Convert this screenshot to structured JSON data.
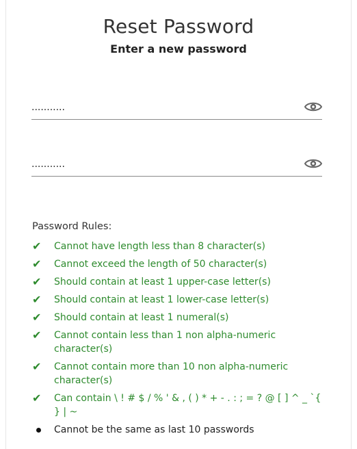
{
  "header": {
    "title": "Reset Password",
    "subtitle": "Enter a new password"
  },
  "fields": [
    {
      "name": "new-password",
      "value": "...........",
      "masked": true,
      "icon": "eye-icon"
    },
    {
      "name": "confirm-password",
      "value": "...........",
      "masked": true,
      "icon": "eye-icon"
    }
  ],
  "rules": {
    "title": "Password Rules:",
    "items": [
      {
        "text": "Cannot have length less than 8 character(s)",
        "status": "met"
      },
      {
        "text": "Cannot exceed the length of 50 character(s)",
        "status": "met"
      },
      {
        "text": "Should contain at least 1 upper-case letter(s)",
        "status": "met"
      },
      {
        "text": "Should contain at least 1 lower-case letter(s)",
        "status": "met"
      },
      {
        "text": "Should contain at least 1 numeral(s)",
        "status": "met"
      },
      {
        "text": "Cannot contain less than 1 non alpha-numeric character(s)",
        "status": "met"
      },
      {
        "text": "Cannot contain more than 10 non alpha-numeric character(s)",
        "status": "met"
      },
      {
        "text": "Can contain \\ ! # $ / % ' & , ( ) * + - . : ; = ? @ [ ] ^ _ `{ } | ~",
        "status": "met"
      },
      {
        "text": "Cannot be the same as last 10 passwords",
        "status": "pending"
      }
    ]
  },
  "colors": {
    "success": "#2e8b2e",
    "text": "#333333",
    "underline": "#8a8a8a"
  }
}
